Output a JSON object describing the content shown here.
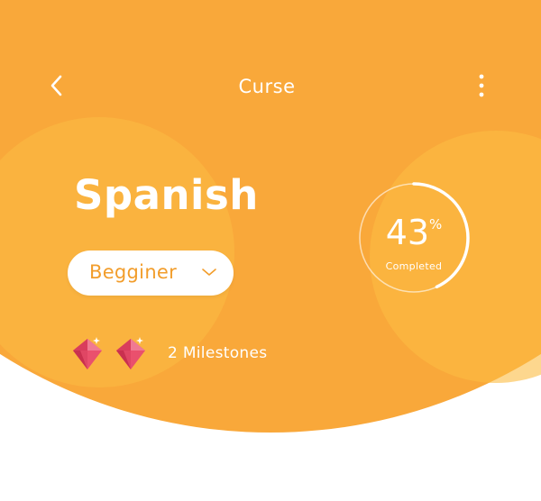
{
  "header": {
    "title": "Curse",
    "back_icon": "chevron-left-icon",
    "menu_icon": "more-vertical-icon"
  },
  "course": {
    "title": "Spanish",
    "level": "Begginer",
    "level_icon": "chevron-down-icon"
  },
  "progress": {
    "value": "43",
    "unit": "%",
    "fraction": 0.43,
    "caption": "Completed"
  },
  "milestones": {
    "count": 2,
    "label": "2 Milestones",
    "icon": "gem-icon"
  },
  "colors": {
    "primary": "#F9A83A",
    "accent_circle": "#FBBC43",
    "pill_text": "#F29D2B",
    "gem": "#E9506D",
    "text_light": "#FFFFFF"
  }
}
